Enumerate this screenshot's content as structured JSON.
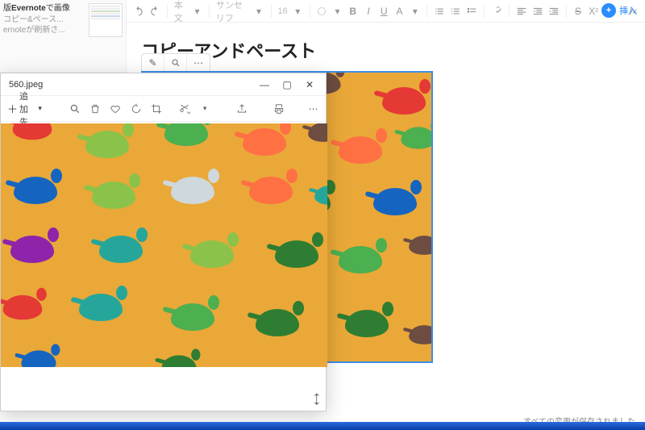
{
  "toolbar": {
    "style_label": "本文",
    "font_label": "サンセリフ",
    "font_size": "16",
    "insert_label": "挿入"
  },
  "sidebar": {
    "line1_prefix": "版",
    "line1_bold": "Evernote",
    "line1_suffix": "で画像",
    "line2": "コピー&ペース...",
    "line3": "ernoteが刷新さ..."
  },
  "editor": {
    "title": "コピーアンドペースト"
  },
  "viewer": {
    "filename": "560.jpeg",
    "add_dest": "追加先"
  },
  "status": {
    "text": "すべての変更が保存されました"
  }
}
